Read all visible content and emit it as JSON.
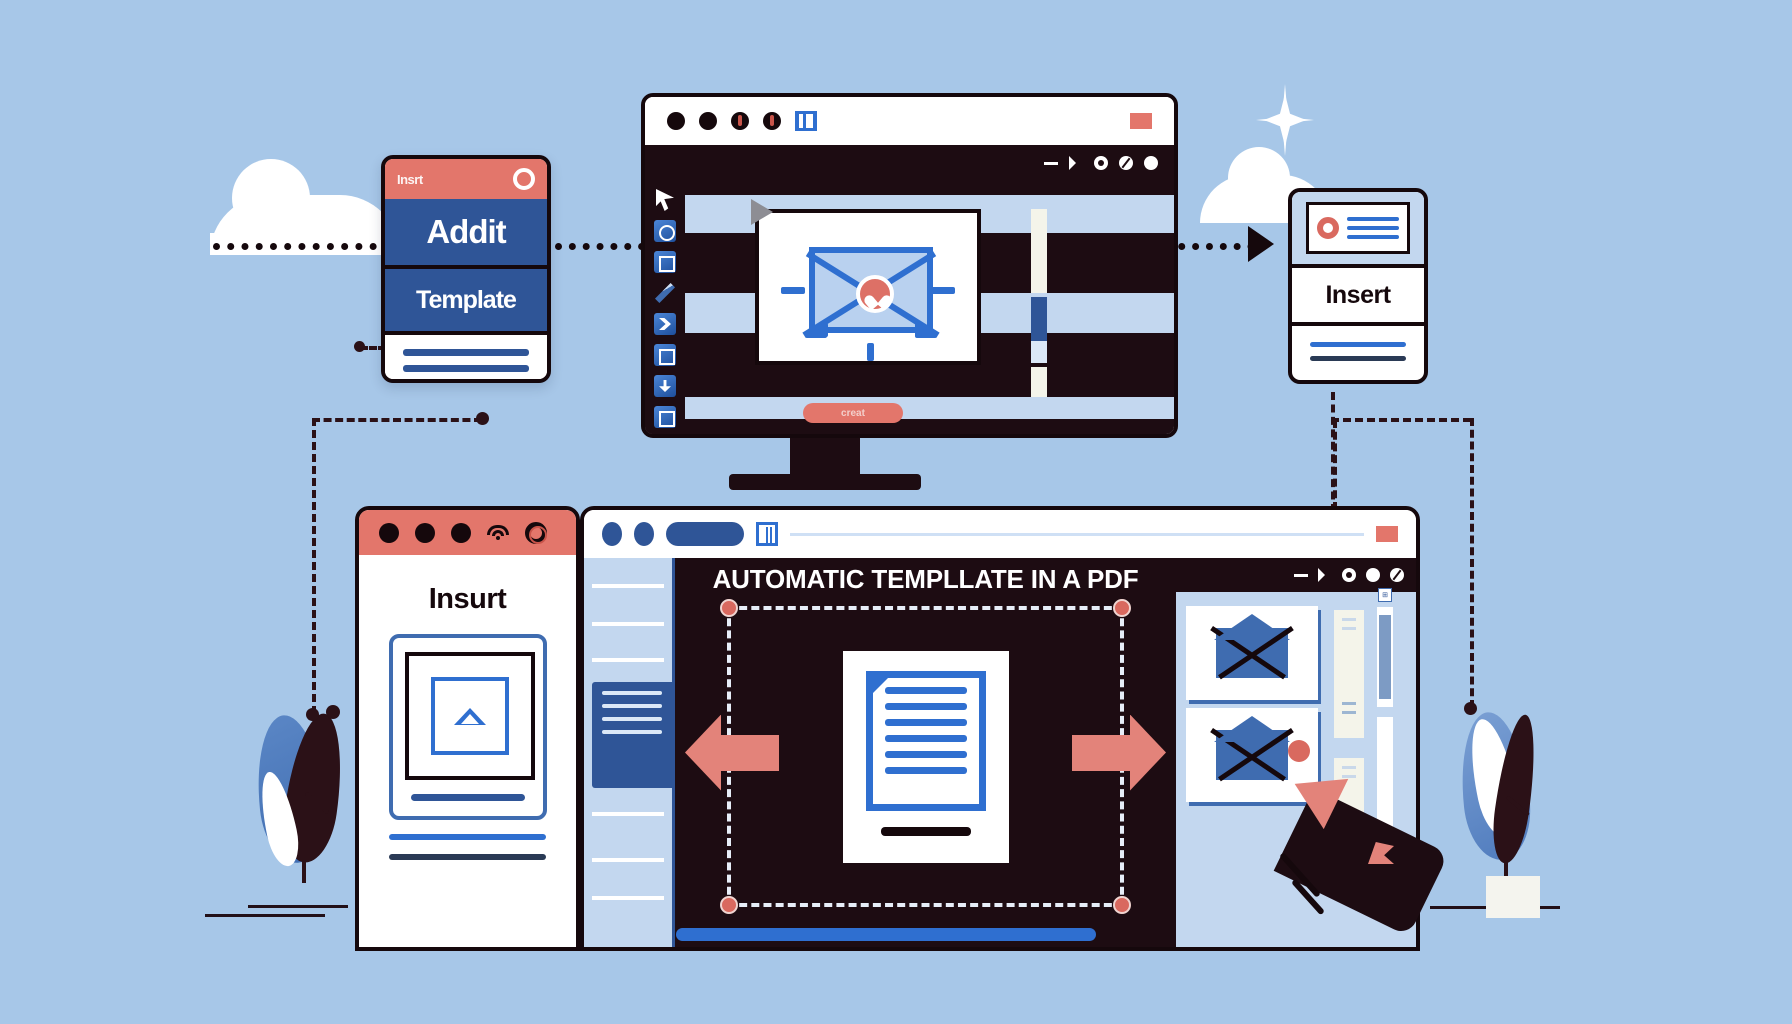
{
  "scene": {
    "title": "Automatic template in a PDF workflow illustration",
    "background_color": "#a7c7e8",
    "accent_blue": "#2f6fd0",
    "deep_blue": "#2f5597",
    "accent_coral": "#e3766b",
    "ink": "#15080c"
  },
  "left_card": {
    "top_bar_label": "Insrt",
    "top_bar_color": "#e3766b",
    "icon": "circle-outline-icon",
    "band_one": "Addit",
    "band_two": "Template",
    "body_lines": 2
  },
  "right_card": {
    "icon": "red-donut-icon",
    "preview_lines": 3,
    "label": "Insert",
    "footer_lines": 2
  },
  "monitor": {
    "titlebar": {
      "dots": 4,
      "app_icon": "pause-bars-icon",
      "close_icon": "red-square-icon"
    },
    "window_controls": [
      "minus-icon",
      "play-diamond-icon",
      "circle-o-icon",
      "circle-slash-icon",
      "circle-icon"
    ],
    "toolbar": {
      "cursor": "cursor-arrow-icon",
      "tools": [
        "select-round-icon",
        "crop-square-icon",
        "pen-icon",
        "moon-shape-icon",
        "copy-page-icon",
        "download-icon",
        "save-frame-icon"
      ]
    },
    "canvas": {
      "artwork": "envelope-with-heart-badge",
      "badge_icon": "heart-icon",
      "selection_cursor": "gray-arrow-cursor",
      "handles": 5
    },
    "action_button": "creat",
    "scrollbar": "vertical-scrollbar"
  },
  "left_window": {
    "titlebar": {
      "dots": 3,
      "wifi_icon": "wifi-icon",
      "record_icon": "record-ring-icon",
      "color": "#e3766b"
    },
    "title": "Insurt",
    "placeholder": {
      "icon": "image-placeholder-triangle-icon",
      "caption_bar": true
    },
    "lines": 2
  },
  "main_window": {
    "toolbar": {
      "dots": 2,
      "tab_pill": "active-tab",
      "bracket_icon": "pause-bars-icon",
      "url_bar": "",
      "close_icon": "red-square-icon"
    },
    "window_controls": [
      "minus-icon",
      "play-diamond-icon",
      "circle-o-icon",
      "circle-icon",
      "circle-half-icon"
    ],
    "canvas_title": "AUTOMATIC TEMPLLATE IN A PDF",
    "selection": {
      "handles": 4,
      "handle_color": "#d9695f",
      "border_style": "dashed-white"
    },
    "document_icon": "text-document-icon",
    "arrows": [
      "arrow-left-icon",
      "arrow-right-icon"
    ],
    "left_panel": {
      "rows": 3,
      "swatch_panel_lines": 4
    },
    "right_panel": {
      "cards": [
        "envelope-card",
        "envelope-card"
      ],
      "strips": 2,
      "scrollbars": 2,
      "mini_icons": [
        "grid-icon",
        "grid-icon"
      ],
      "marker_dot": "#d9695f",
      "cursor": "pencil-cursor-icon"
    },
    "bottom_bar": "progress-bar"
  },
  "decorations": {
    "clouds": 2,
    "sparkle": "sparkle-icon",
    "plants": [
      "leaf-plant-blue",
      "leaf-plant-white"
    ],
    "connector_paths": 6
  }
}
